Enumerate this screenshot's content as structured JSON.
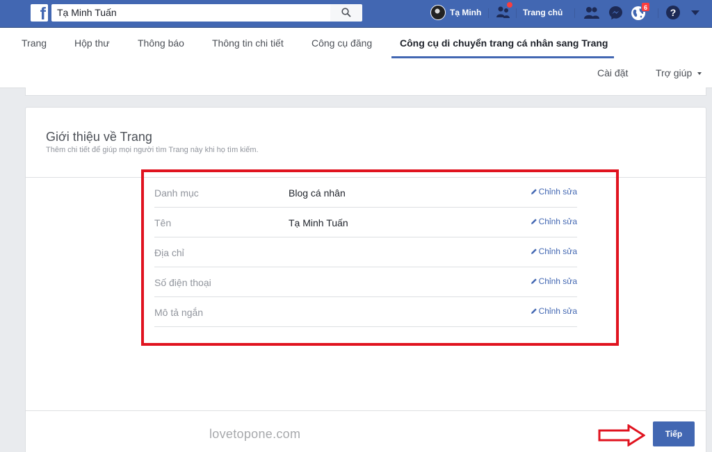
{
  "topbar": {
    "search_value": "Tạ Minh Tuấn",
    "profile_name": "Tạ Minh",
    "home_label": "Trang chủ",
    "notifications_count": "6",
    "help_glyph": "?",
    "icons": [
      "facebook-logo",
      "search-icon",
      "friend-requests-icon",
      "friends-icon",
      "messenger-icon",
      "globe-notifications-icon",
      "help-icon",
      "account-menu-caret"
    ]
  },
  "subnav": {
    "tabs": [
      {
        "label": "Trang",
        "active": false
      },
      {
        "label": "Hộp thư",
        "active": false
      },
      {
        "label": "Thông báo",
        "active": false
      },
      {
        "label": "Thông tin chi tiết",
        "active": false
      },
      {
        "label": "Công cụ đăng",
        "active": false
      },
      {
        "label": "Công cụ di chuyển trang cá nhân sang Trang",
        "active": true
      }
    ],
    "settings_label": "Cài đặt",
    "help_label": "Trợ giúp"
  },
  "card": {
    "title": "Giới thiệu về Trang",
    "subtitle": "Thêm chi tiết để giúp mọi người tìm Trang này khi họ tìm kiếm.",
    "rows": [
      {
        "label": "Danh mục",
        "value": "Blog cá nhân",
        "edit": "Chỉnh sửa"
      },
      {
        "label": "Tên",
        "value": "Tạ Minh Tuấn",
        "edit": "Chỉnh sửa"
      },
      {
        "label": "Địa chỉ",
        "value": "",
        "edit": "Chỉnh sửa"
      },
      {
        "label": "Số điện thoại",
        "value": "",
        "edit": "Chỉnh sửa"
      },
      {
        "label": "Mô tả ngắn",
        "value": "",
        "edit": "Chỉnh sửa"
      }
    ]
  },
  "footer": {
    "watermark": "lovetopone.com",
    "next_label": "Tiếp"
  },
  "colors": {
    "brand_blue": "#4267b2",
    "highlight_red": "#e0131f",
    "badge_red": "#fa3e3e"
  }
}
